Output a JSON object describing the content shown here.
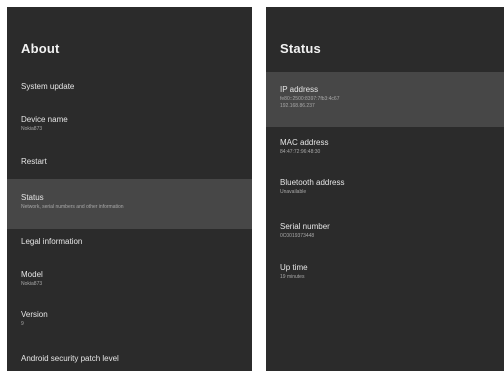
{
  "about": {
    "title": "About",
    "items": [
      {
        "label": "System update",
        "value": ""
      },
      {
        "label": "Device name",
        "value": "Nokia873"
      },
      {
        "label": "Restart",
        "value": ""
      },
      {
        "label": "Status",
        "value": "Network, serial numbers and other information"
      },
      {
        "label": "Legal information",
        "value": ""
      },
      {
        "label": "Model",
        "value": "Nokia873"
      },
      {
        "label": "Version",
        "value": "9"
      },
      {
        "label": "Android security patch level",
        "value": ""
      }
    ]
  },
  "status": {
    "title": "Status",
    "items": [
      {
        "label": "IP address",
        "value": "fe80::2500:8397:7fb3:4c67",
        "value2": "192.168.86.237"
      },
      {
        "label": "MAC address",
        "value": "84:47:72:96:48:30"
      },
      {
        "label": "Bluetooth address",
        "value": "Unavailable"
      },
      {
        "label": "Serial number",
        "value": "0C0019373448"
      },
      {
        "label": "Up time",
        "value": "19 minutes"
      }
    ]
  },
  "colors": {
    "panel_background": "#2b2b2b",
    "selected_background": "#474747",
    "label_text": "#e6e6e6",
    "secondary_text": "#a8a8a8"
  }
}
